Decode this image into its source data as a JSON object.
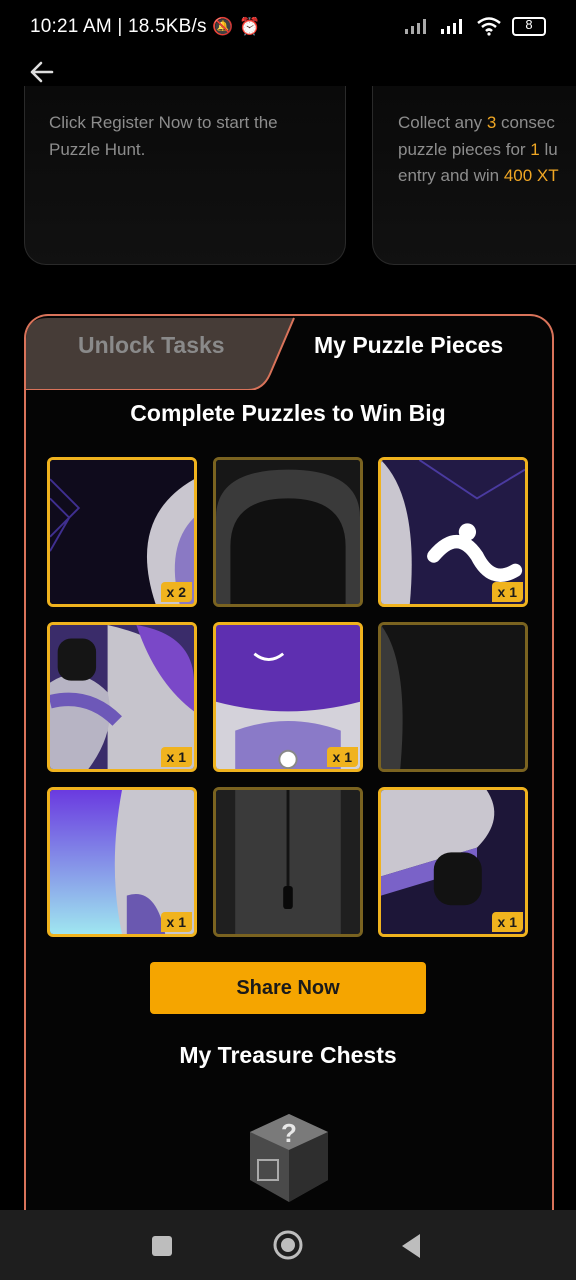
{
  "status_bar": {
    "time_speed": "10:21 AM | 18.5KB/s",
    "battery": "8"
  },
  "info_cards": {
    "left_text": "Click Register Now to start the Puzzle Hunt.",
    "right_line1_pre": "Collect any ",
    "right_line1_num": "3",
    "right_line1_post": " consec",
    "right_line2_pre": "puzzle pieces for ",
    "right_line2_num": "1",
    "right_line2_post": " lu",
    "right_line3_pre": "entry and win ",
    "right_line3_num": "400 XT"
  },
  "tabs": {
    "unlock": "Unlock Tasks",
    "mine": "My Puzzle Pieces"
  },
  "headline": "Complete Puzzles to Win Big",
  "pieces": [
    {
      "count": "x 2",
      "owned": true
    },
    {
      "count": "",
      "owned": false
    },
    {
      "count": "x 1",
      "owned": true
    },
    {
      "count": "x 1",
      "owned": true
    },
    {
      "count": "x 1",
      "owned": true
    },
    {
      "count": "",
      "owned": false
    },
    {
      "count": "x 1",
      "owned": true
    },
    {
      "count": "",
      "owned": false
    },
    {
      "count": "x 1",
      "owned": true
    }
  ],
  "share_button": "Share Now",
  "chests_title": "My Treasure Chests",
  "colors": {
    "accent": "#f5a500",
    "panel_border": "#d9735a",
    "tile_border": "#f0b31e",
    "highlight_text": "#f0a724"
  }
}
